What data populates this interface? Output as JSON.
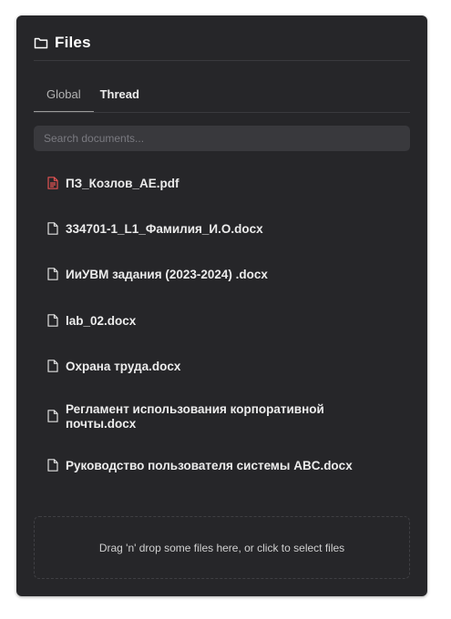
{
  "header": {
    "title": "Files",
    "icon": "folder-icon"
  },
  "tabs": [
    {
      "label": "Global",
      "active": true
    },
    {
      "label": "Thread",
      "active": false
    }
  ],
  "search": {
    "placeholder": "Search documents...",
    "value": ""
  },
  "files": [
    {
      "name": "ПЗ_Козлов_АЕ.pdf",
      "icon": "pdf-file-icon",
      "icon_color": "#e05252"
    },
    {
      "name": "334701-1_L1_Фамилия_И.О.docx",
      "icon": "file-icon"
    },
    {
      "name": "ИиУВМ задания (2023-2024) .docx",
      "icon": "file-icon"
    },
    {
      "name": "lab_02.docx",
      "icon": "file-icon"
    },
    {
      "name": "Охрана труда.docx",
      "icon": "file-icon"
    },
    {
      "name": "Регламент использования корпоративной почты.docx",
      "icon": "file-icon"
    },
    {
      "name": "Руководство пользователя системы ABC.docx",
      "icon": "file-icon"
    }
  ],
  "dropzone": {
    "text": "Drag 'n' drop some files here, or click to select files"
  },
  "colors": {
    "panel_bg": "#262629",
    "text": "#ececec",
    "pdf_accent": "#e05252"
  }
}
